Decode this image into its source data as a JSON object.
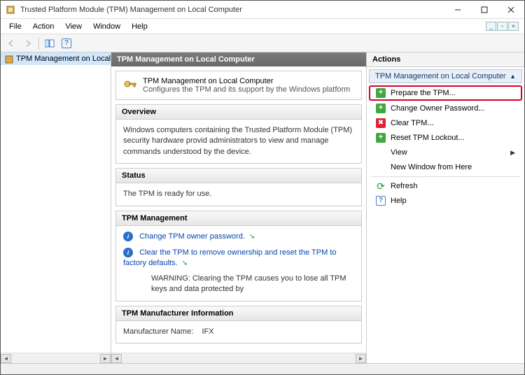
{
  "window": {
    "title": "Trusted Platform Module (TPM) Management on Local Computer"
  },
  "menubar": {
    "file": "File",
    "action": "Action",
    "view": "View",
    "window": "Window",
    "help": "Help"
  },
  "tree": {
    "root": "TPM Management on Local Comput"
  },
  "center": {
    "title": "TPM Management on Local Computer",
    "intro_title": "TPM Management on Local Computer",
    "intro_desc": "Configures the TPM and its support by the Windows platform",
    "overview": {
      "heading": "Overview",
      "body": "Windows computers containing the Trusted Platform Module (TPM) security hardware provid administrators to view and manage commands understood by the device."
    },
    "status": {
      "heading": "Status",
      "body": "The TPM is ready for use."
    },
    "mgmt": {
      "heading": "TPM Management",
      "change_pw": "Change TPM owner password.",
      "clear_tpm": "Clear the TPM to remove ownership and reset the TPM to factory defaults.",
      "warning": "WARNING: Clearing the TPM causes you to lose all TPM keys and data protected by"
    },
    "manuf": {
      "heading": "TPM Manufacturer Information",
      "name_label": "Manufacturer Name:",
      "name_value": "IFX"
    }
  },
  "actions": {
    "title": "Actions",
    "section": "TPM Management on Local Computer",
    "prepare": "Prepare the TPM...",
    "change_owner": "Change Owner Password...",
    "clear": "Clear TPM...",
    "reset": "Reset TPM Lockout...",
    "view": "View",
    "new_window": "New Window from Here",
    "refresh": "Refresh",
    "help": "Help"
  }
}
